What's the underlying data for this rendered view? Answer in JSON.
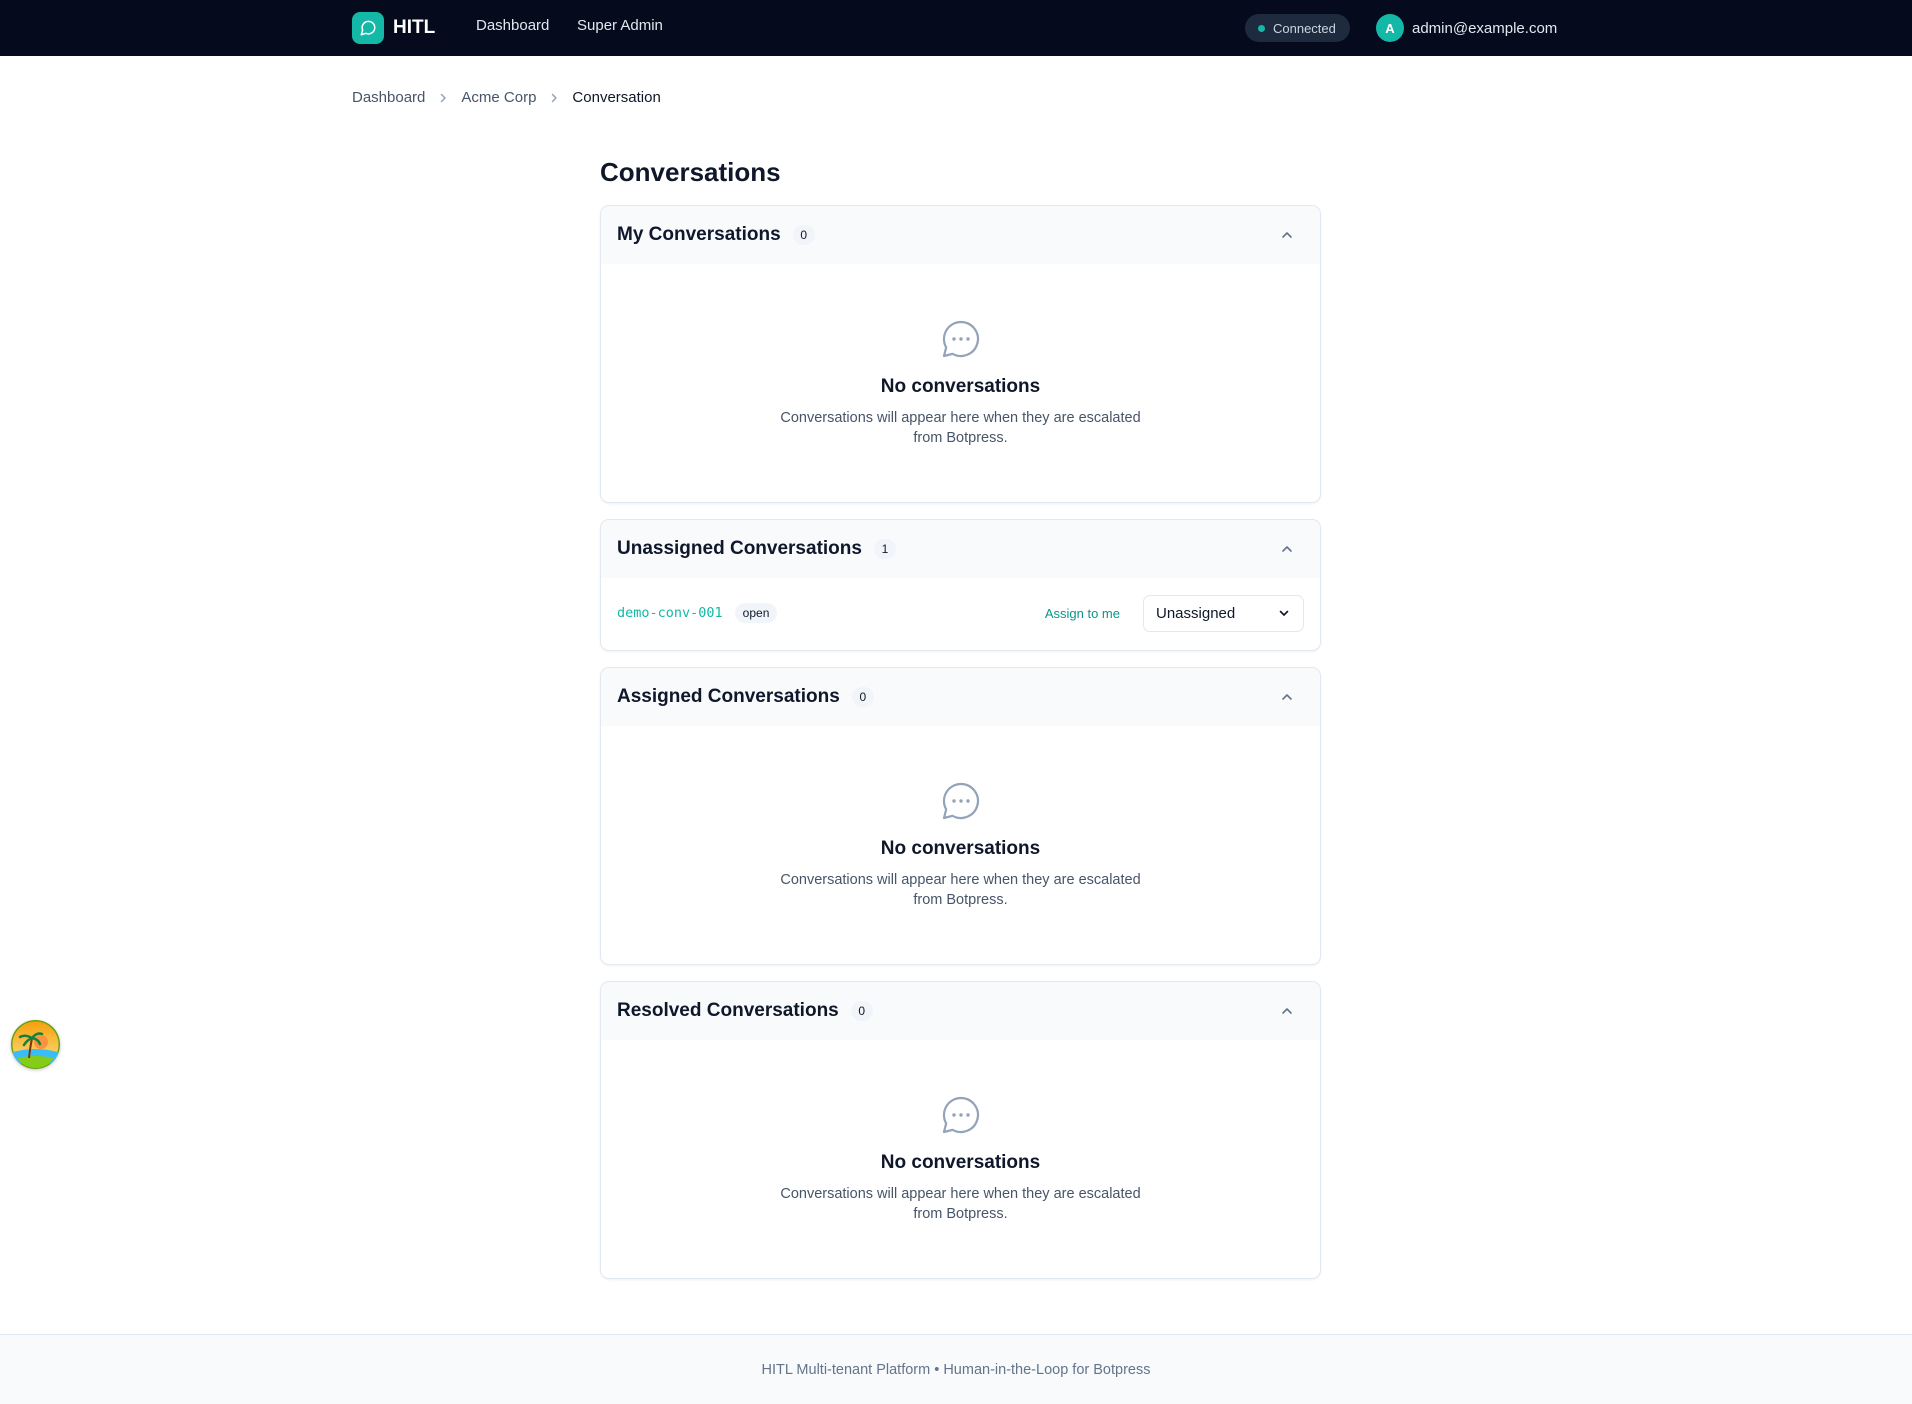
{
  "nav": {
    "brand": "HITL",
    "links": [
      "Dashboard",
      "Super Admin"
    ],
    "status": "Connected",
    "avatar_initial": "A",
    "user_email": "admin@example.com"
  },
  "breadcrumb": {
    "items": [
      "Dashboard",
      "Acme Corp"
    ],
    "current": "Conversation"
  },
  "main": {
    "title": "Conversations",
    "empty_title": "No conversations",
    "empty_text": "Conversations will appear here when they are escalated from Botpress.",
    "sections": [
      {
        "title": "My Conversations",
        "count": "0"
      },
      {
        "title": "Unassigned Conversations",
        "count": "1"
      },
      {
        "title": "Assigned Conversations",
        "count": "0"
      },
      {
        "title": "Resolved Conversations",
        "count": "0"
      }
    ],
    "unassigned_row": {
      "id": "demo-conv-001",
      "status": "open",
      "assign_label": "Assign to me",
      "select_value": "Unassigned"
    }
  },
  "footer": {
    "text": "HITL Multi-tenant Platform • Human-in-the-Loop for Botpress"
  },
  "colors": {
    "accent": "#14b8a6",
    "nav_bg": "#050b1d"
  }
}
